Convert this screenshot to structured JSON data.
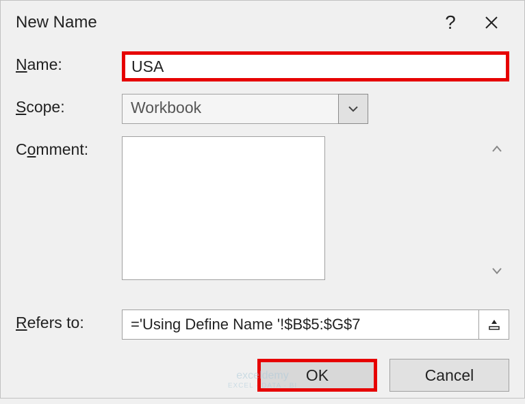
{
  "dialog": {
    "title": "New Name"
  },
  "fields": {
    "name_label": "Name:",
    "name_value": "USA",
    "scope_label": "Scope:",
    "scope_value": "Workbook",
    "comment_label": "Comment:",
    "comment_value": "",
    "refers_label": "Refers to:",
    "refers_value": "='Using Define Name '!$B$5:$G$7"
  },
  "buttons": {
    "ok": "OK",
    "cancel": "Cancel"
  },
  "watermark": {
    "brand": "exceldemy",
    "tagline": "EXCEL · DATA · BI"
  }
}
